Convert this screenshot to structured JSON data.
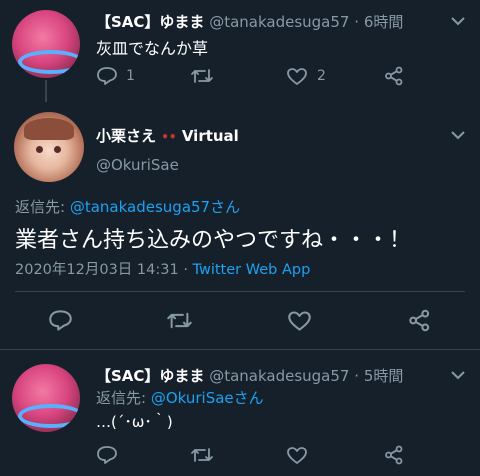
{
  "colors": {
    "background": "#15202b",
    "text": "#ffffff",
    "muted": "#8899a6",
    "link": "#1da1f2",
    "divider": "#38444d"
  },
  "tweet1": {
    "display_name": "【SAC】ゆまま",
    "handle": "@tanakadesuga57",
    "separator": "·",
    "time": "6時間",
    "text": "灰皿でなんか草",
    "reply_count": "1",
    "like_count": "2"
  },
  "main": {
    "display_name": "小栗さえ",
    "name_suffix": "Virtual",
    "handle": "@OkuriSae",
    "reply_label": "返信先:",
    "reply_to": "@tanakadesuga57さん",
    "text": "業者さん持ち込みのやつですね・・・！",
    "timestamp": "2020年12月03日 14:31",
    "separator": "·",
    "client": "Twitter Web App"
  },
  "tweet3": {
    "display_name": "【SAC】ゆまま",
    "handle": "@tanakadesuga57",
    "separator": "·",
    "time": "5時間",
    "reply_label": "返信先:",
    "reply_to": "@OkuriSaeさん",
    "text": "…(´･ω･｀)"
  },
  "icons": [
    "reply-icon",
    "retweet-icon",
    "like-icon",
    "share-icon",
    "chevron-down-icon"
  ]
}
